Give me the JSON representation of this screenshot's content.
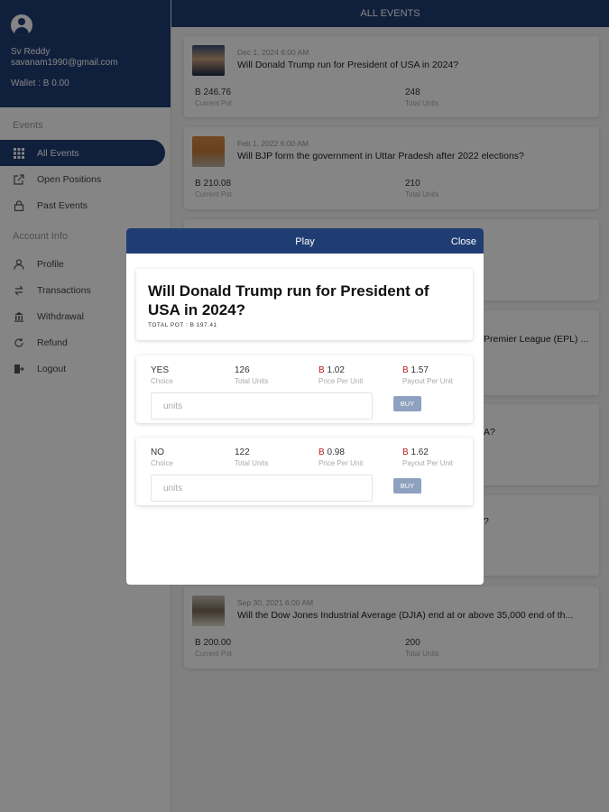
{
  "user": {
    "name": "Sv Reddy",
    "email": "savanam1990@gmail.com",
    "wallet": "Wallet : B 0.00"
  },
  "sidebar": {
    "events_heading": "Events",
    "account_heading": "Account Info",
    "items": [
      {
        "label": "All Events",
        "icon": "grid-icon"
      },
      {
        "label": "Open Positions",
        "icon": "external-link-icon"
      },
      {
        "label": "Past Events",
        "icon": "lock-icon"
      },
      {
        "label": "Profile",
        "icon": "person-icon"
      },
      {
        "label": "Transactions",
        "icon": "swap-icon"
      },
      {
        "label": "Withdrawal",
        "icon": "bank-icon"
      },
      {
        "label": "Refund",
        "icon": "refresh-icon"
      },
      {
        "label": "Logout",
        "icon": "logout-icon"
      }
    ]
  },
  "header": {
    "title": "ALL EVENTS"
  },
  "events": [
    {
      "date": "Dec 1, 2024 6:00 AM",
      "question": "Will Donald Trump run for President of USA in 2024?",
      "pot": "B 246.76",
      "pot_label": "Current Pot",
      "units": "248",
      "units_label": "Total Units"
    },
    {
      "date": "Feb 1, 2022 6:00 AM",
      "question": "Will BJP form the government in Uttar Pradesh after 2022 elections?",
      "pot": "B 210.08",
      "pot_label": "Current Pot",
      "units": "210",
      "units_label": "Total Units"
    },
    {
      "question_fragment": "Premier League (EPL) ..."
    },
    {
      "question_fragment": "A?"
    },
    {
      "question_fragment": "?"
    },
    {
      "date": "Sep 30, 2021 6:00 AM",
      "question": "Will the Dow Jones Industrial Average (DJIA) end at or above 35,000 end of th...",
      "pot": "B 200.00",
      "pot_label": "Current Pot",
      "units": "200",
      "units_label": "Total Units"
    }
  ],
  "modal": {
    "title": "Play",
    "close": "Close",
    "question": "Will Donald Trump run for President of USA in 2024?",
    "total_pot": "TOTAL POT : B 197.41",
    "options": [
      {
        "choice": "YES",
        "choice_label": "Choice",
        "units": "126",
        "units_label": "Total Units",
        "price_sym": "B",
        "price": "1.02",
        "price_label": "Price Per Unit",
        "payout_sym": "B",
        "payout": "1.57",
        "payout_label": "Payout Per Unit",
        "placeholder": "units",
        "buy": "BUY"
      },
      {
        "choice": "NO",
        "choice_label": "Choice",
        "units": "122",
        "units_label": "Total Units",
        "price_sym": "B",
        "price": "0.98",
        "price_label": "Price Per Unit",
        "payout_sym": "B",
        "payout": "1.62",
        "payout_label": "Payout Per Unit",
        "placeholder": "units",
        "buy": "BUY"
      }
    ]
  },
  "colors": {
    "primary": "#1f3d73",
    "currency": "#b31c1c",
    "buy_button": "#8ea2c0"
  }
}
